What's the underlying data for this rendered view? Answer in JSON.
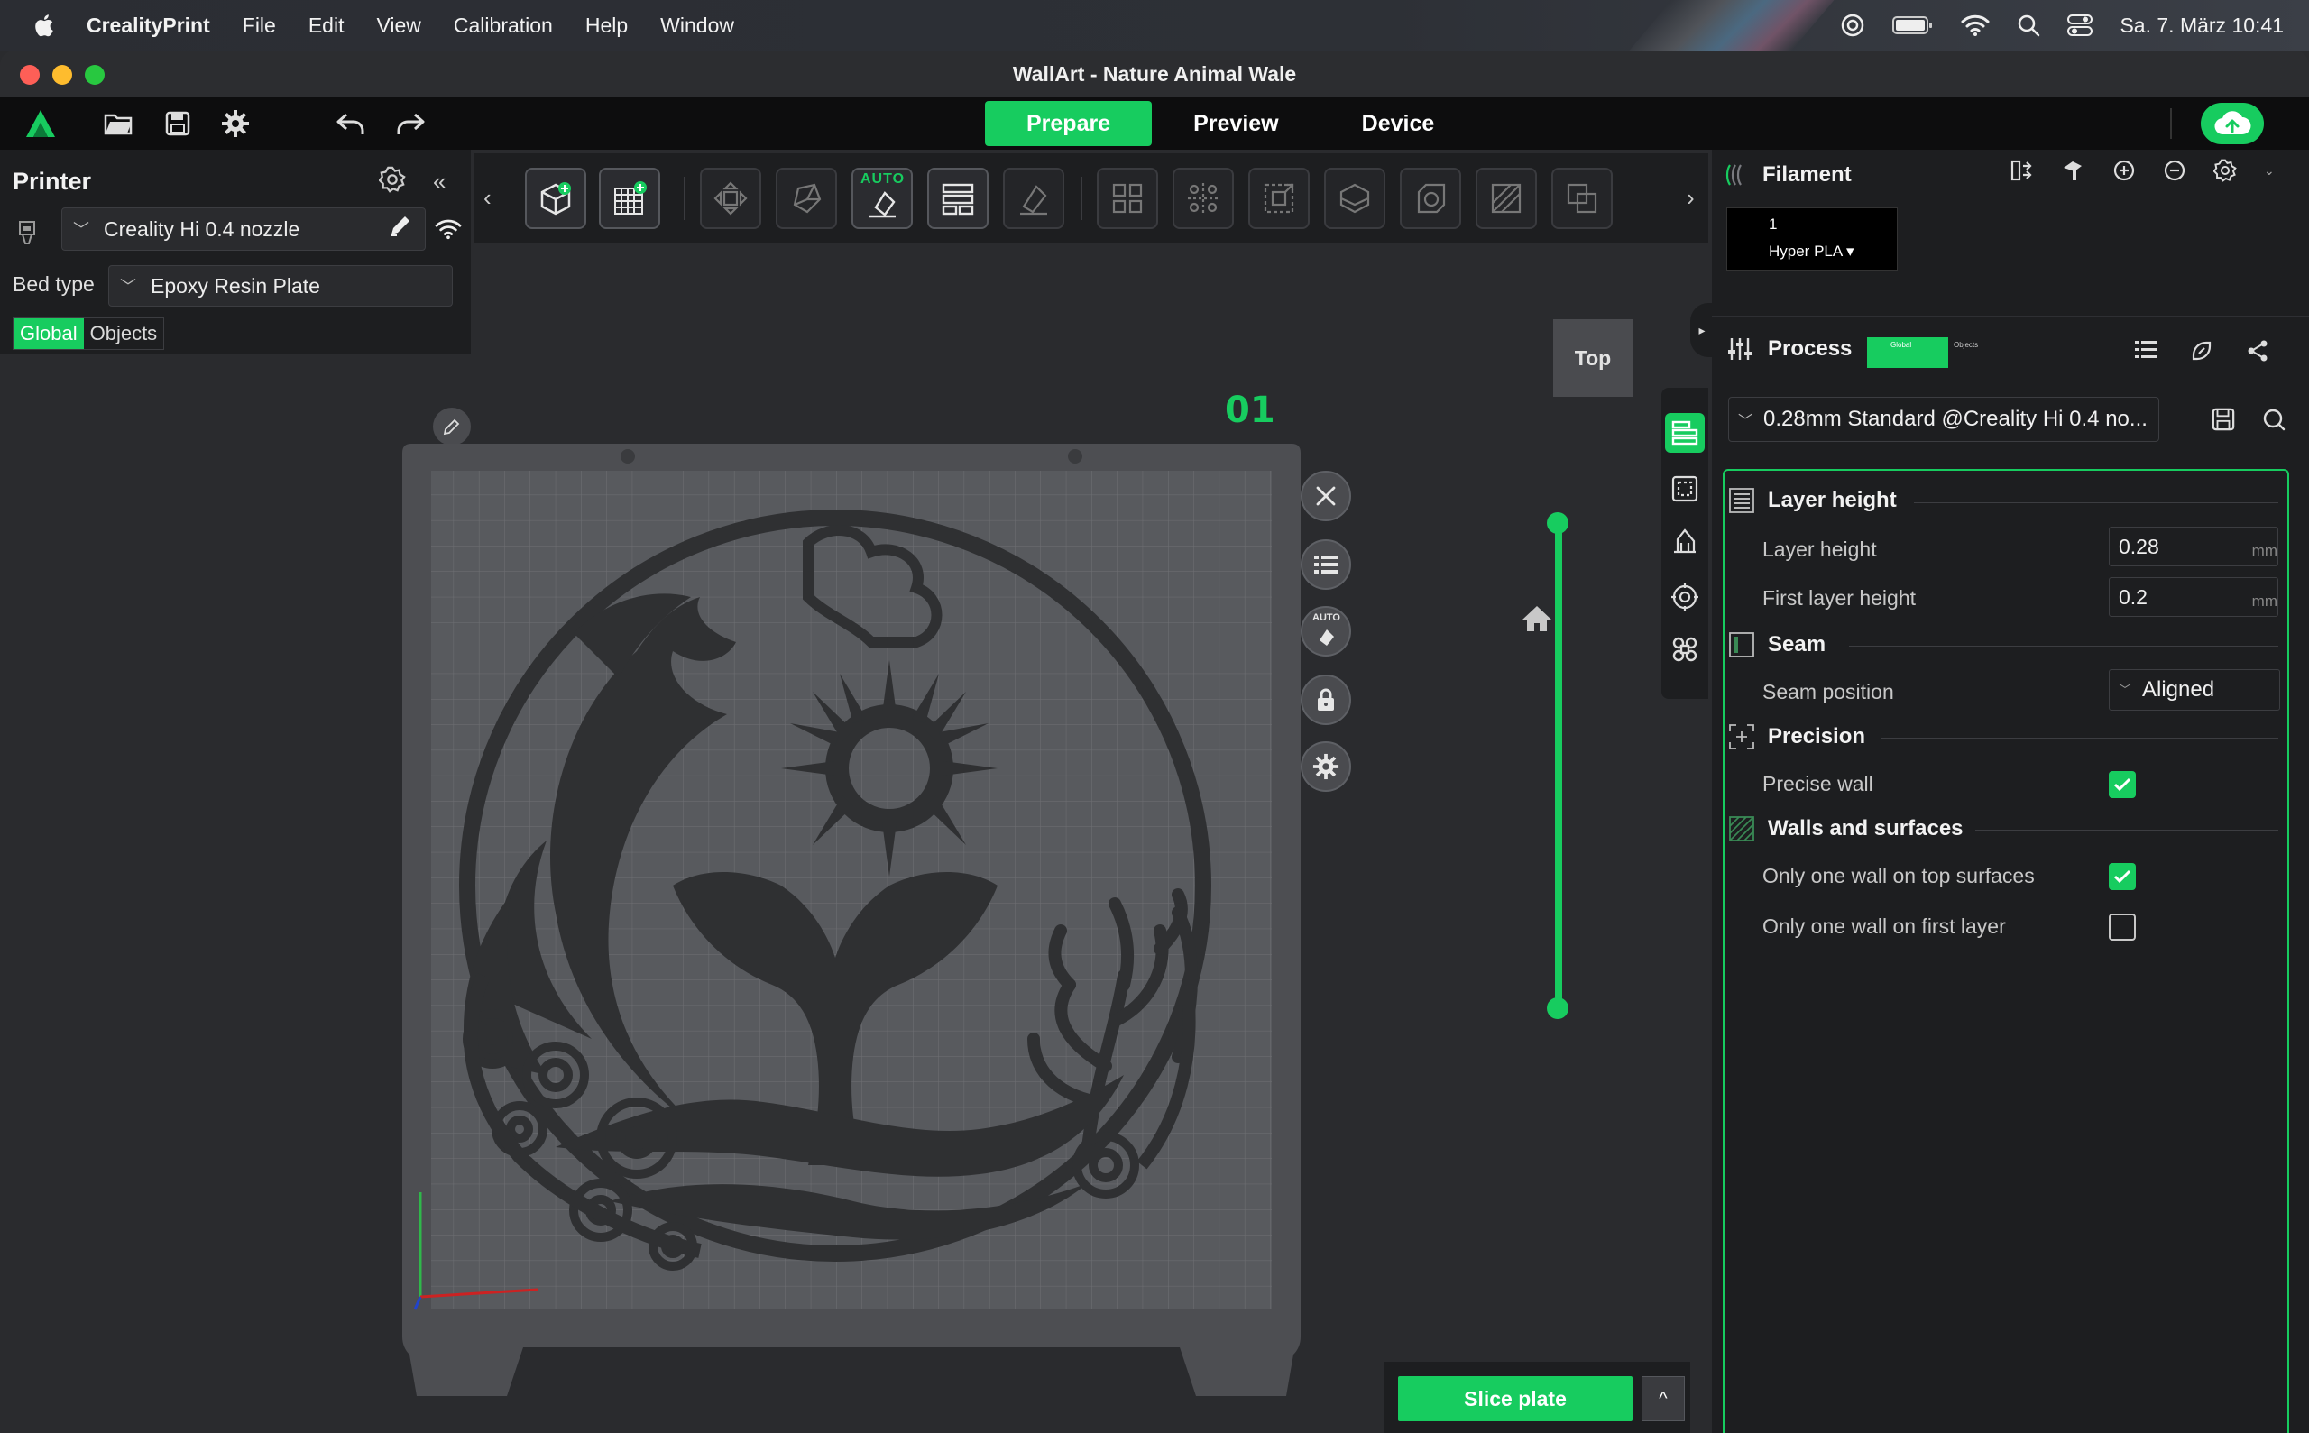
{
  "menubar": {
    "app_name": "CrealityPrint",
    "items": [
      "File",
      "Edit",
      "View",
      "Calibration",
      "Help",
      "Window"
    ],
    "datetime": "Sa. 7. März  10:41"
  },
  "window": {
    "title": "WallArt - Nature Animal Wale"
  },
  "toolbar": {
    "tabs": [
      {
        "label": "Prepare",
        "active": true
      },
      {
        "label": "Preview",
        "active": false
      },
      {
        "label": "Device",
        "active": false
      }
    ]
  },
  "printer": {
    "title": "Printer",
    "nozzle": "Creality Hi 0.4 nozzle",
    "bed_label": "Bed type",
    "bed_value": "Epoxy Resin Plate",
    "tabs": [
      {
        "label": "Global",
        "active": true
      },
      {
        "label": "Objects",
        "active": false
      }
    ]
  },
  "object_toolbar": {
    "auto_tag": "AUTO"
  },
  "viewport": {
    "view_label": "Top",
    "plate_number": "01",
    "auto_tag": "AUTO",
    "layer_slider_range": [
      0,
      1
    ]
  },
  "slice": {
    "button": "Slice plate",
    "more": "^"
  },
  "filament": {
    "title": "Filament",
    "slot_number": "1",
    "material": "Hyper PLA"
  },
  "process": {
    "title": "Process",
    "toggle_on": "Global",
    "toggle_off": "Objects",
    "preset": "0.28mm Standard @Creality Hi 0.4 no...",
    "sections": {
      "layer_height": "Layer height",
      "seam": "Seam",
      "precision": "Precision",
      "walls": "Walls and surfaces"
    },
    "fields": {
      "layer_height_label": "Layer height",
      "layer_height_value": "0.28",
      "first_layer_label": "First layer height",
      "first_layer_value": "0.2",
      "unit": "mm",
      "seam_position_label": "Seam position",
      "seam_position_value": "Aligned",
      "precise_wall_label": "Precise wall",
      "precise_wall_checked": true,
      "one_wall_top_label": "Only one wall on top surfaces",
      "one_wall_top_checked": true,
      "one_wall_first_label": "Only one wall on first layer",
      "one_wall_first_checked": false
    }
  },
  "colors": {
    "accent": "#17cc5f",
    "panel": "#1d1e20",
    "viewport": "#2a2b2e",
    "model": "#2f3032"
  }
}
